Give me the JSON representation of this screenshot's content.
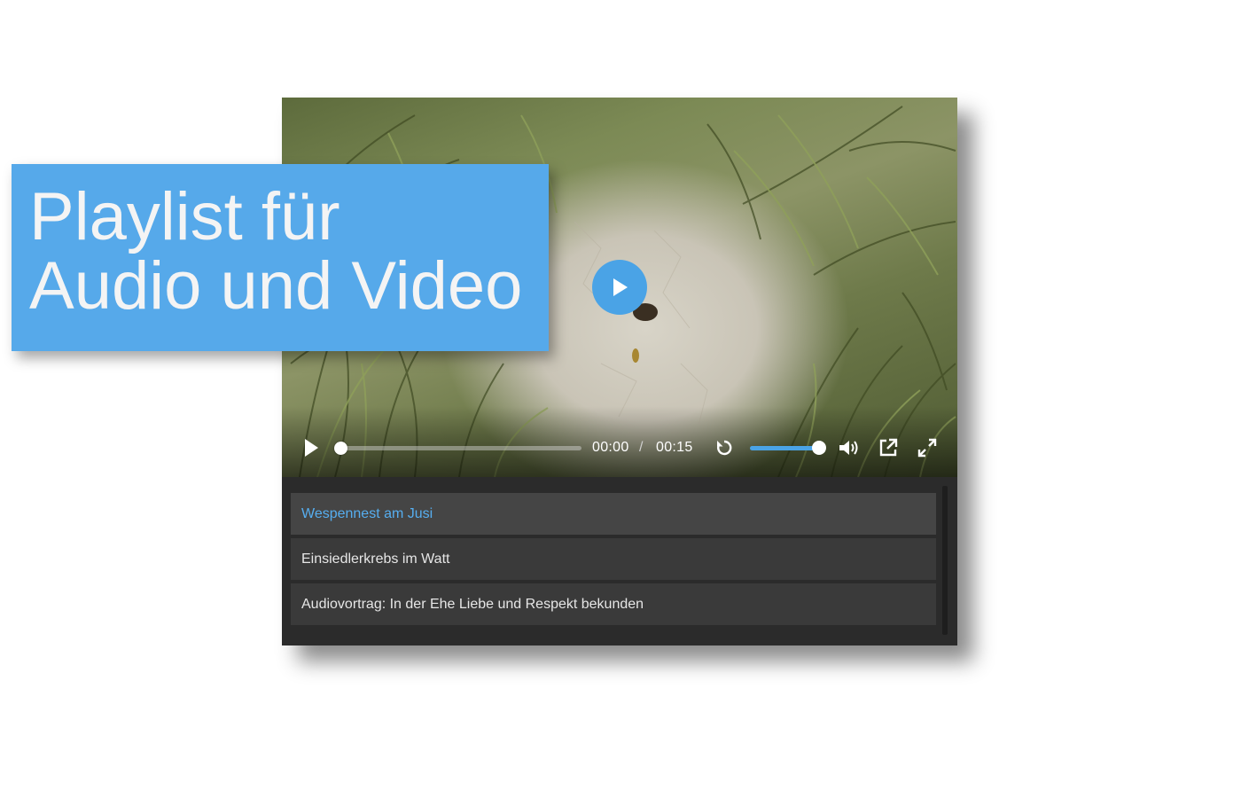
{
  "banner": {
    "line1": "Playlist für",
    "line2": "Audio und Video"
  },
  "player": {
    "progress": 0.0,
    "volume": 1.0,
    "controls": {
      "play_icon": "play-icon",
      "current_time": "00:00",
      "separator": "/",
      "duration": "00:15",
      "restart_icon": "restart-icon",
      "volume_icon": "speaker-icon",
      "popout_icon": "external-link-icon",
      "fullscreen_icon": "fullscreen-icon"
    },
    "accent_color": "#4aa3e6"
  },
  "playlist": {
    "items": [
      {
        "label": "Wespennest am Jusi",
        "active": true
      },
      {
        "label": "Einsiedlerkrebs im Watt",
        "active": false
      },
      {
        "label": "Audiovortrag: In der Ehe Liebe und Respekt bekunden",
        "active": false
      }
    ],
    "active_color": "#56aef0"
  }
}
